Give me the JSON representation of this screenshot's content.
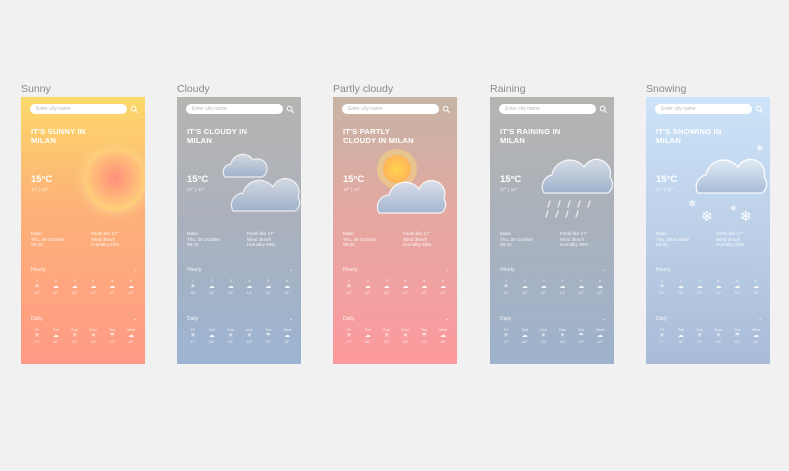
{
  "boards": [
    {
      "title": "Sunny",
      "search_placeholder": "Enter city name",
      "headline": "IT'S SUNNY IN MILAN",
      "temp": "15°C",
      "range": "17° | 12°",
      "info_left": [
        "Milan",
        "Thu, 29 October",
        "09:32"
      ],
      "info_right": [
        "Feels like 17°",
        "Wind 3km/h",
        "Humidity 60%"
      ],
      "hourly_label": "Hourly",
      "daily_label": "Daily",
      "hourly": [
        {
          "t": "1",
          "icon": "sun",
          "v": "15°"
        },
        {
          "t": "2",
          "icon": "cloud",
          "v": "16°"
        },
        {
          "t": "3",
          "icon": "cloud",
          "v": "15°"
        },
        {
          "t": "4",
          "icon": "cloud",
          "v": "14°"
        },
        {
          "t": "5",
          "icon": "cloud",
          "v": "15°"
        },
        {
          "t": "6",
          "icon": "cloud",
          "v": "14°"
        }
      ],
      "daily": [
        {
          "d": "Fri",
          "icon": "sun",
          "v": "17°"
        },
        {
          "d": "Sat",
          "icon": "cloud",
          "v": "16°"
        },
        {
          "d": "Sun",
          "icon": "sun",
          "v": "15°"
        },
        {
          "d": "Mon",
          "icon": "sun",
          "v": "16°"
        },
        {
          "d": "Tue",
          "icon": "rain",
          "v": "13°"
        },
        {
          "d": "Wed",
          "icon": "cloud",
          "v": "14°"
        }
      ]
    },
    {
      "title": "Cloudy",
      "search_placeholder": "Enter city name",
      "headline": "IT'S CLOUDY IN MILAN",
      "temp": "15°C",
      "range": "17° | 12°",
      "info_left": [
        "Milan",
        "Thu, 29 October",
        "09:32"
      ],
      "info_right": [
        "Feels like 17°",
        "Wind 3km/h",
        "Humidity 60%"
      ],
      "hourly_label": "Hourly",
      "daily_label": "Daily",
      "hourly": [
        {
          "t": "1",
          "icon": "sun",
          "v": "15°"
        },
        {
          "t": "2",
          "icon": "cloud",
          "v": "16°"
        },
        {
          "t": "3",
          "icon": "cloud",
          "v": "15°"
        },
        {
          "t": "4",
          "icon": "cloud",
          "v": "14°"
        },
        {
          "t": "5",
          "icon": "cloud",
          "v": "15°"
        },
        {
          "t": "6",
          "icon": "cloud",
          "v": "14°"
        }
      ],
      "daily": [
        {
          "d": "Fri",
          "icon": "sun",
          "v": "17°"
        },
        {
          "d": "Sat",
          "icon": "cloud",
          "v": "16°"
        },
        {
          "d": "Sun",
          "icon": "sun",
          "v": "15°"
        },
        {
          "d": "Mon",
          "icon": "sun",
          "v": "16°"
        },
        {
          "d": "Tue",
          "icon": "rain",
          "v": "13°"
        },
        {
          "d": "Wed",
          "icon": "cloud",
          "v": "14°"
        }
      ]
    },
    {
      "title": "Partly cloudy",
      "search_placeholder": "Enter city name",
      "headline": "IT'S PARTLY CLOUDY IN MILAN",
      "temp": "15°C",
      "range": "17° | 12°",
      "info_left": [
        "Milan",
        "Thu, 29 October",
        "09:32"
      ],
      "info_right": [
        "Feels like 17°",
        "Wind 3km/h",
        "Humidity 60%"
      ],
      "hourly_label": "Hourly",
      "daily_label": "Daily",
      "hourly": [
        {
          "t": "1",
          "icon": "sun",
          "v": "15°"
        },
        {
          "t": "2",
          "icon": "cloud",
          "v": "16°"
        },
        {
          "t": "3",
          "icon": "cloud",
          "v": "15°"
        },
        {
          "t": "4",
          "icon": "cloud",
          "v": "14°"
        },
        {
          "t": "5",
          "icon": "cloud",
          "v": "15°"
        },
        {
          "t": "6",
          "icon": "cloud",
          "v": "14°"
        }
      ],
      "daily": [
        {
          "d": "Fri",
          "icon": "sun",
          "v": "17°"
        },
        {
          "d": "Sat",
          "icon": "cloud",
          "v": "16°"
        },
        {
          "d": "Sun",
          "icon": "sun",
          "v": "15°"
        },
        {
          "d": "Mon",
          "icon": "sun",
          "v": "16°"
        },
        {
          "d": "Tue",
          "icon": "rain",
          "v": "13°"
        },
        {
          "d": "Wed",
          "icon": "cloud",
          "v": "14°"
        }
      ]
    },
    {
      "title": "Raining",
      "search_placeholder": "Enter city name",
      "headline": "IT'S RAINING IN MILAN",
      "temp": "15°C",
      "range": "17° | 12°",
      "info_left": [
        "Milan",
        "Thu, 29 October",
        "09:32"
      ],
      "info_right": [
        "Feels like 17°",
        "Wind 3km/h",
        "Humidity 90%"
      ],
      "hourly_label": "Hourly",
      "daily_label": "Daily",
      "hourly": [
        {
          "t": "1",
          "icon": "sun",
          "v": "15°"
        },
        {
          "t": "2",
          "icon": "cloud",
          "v": "16°"
        },
        {
          "t": "3",
          "icon": "cloud",
          "v": "15°"
        },
        {
          "t": "4",
          "icon": "cloud",
          "v": "14°"
        },
        {
          "t": "5",
          "icon": "cloud",
          "v": "15°"
        },
        {
          "t": "6",
          "icon": "cloud",
          "v": "14°"
        }
      ],
      "daily": [
        {
          "d": "Fri",
          "icon": "sun",
          "v": "17°"
        },
        {
          "d": "Sat",
          "icon": "cloud",
          "v": "16°"
        },
        {
          "d": "Sun",
          "icon": "sun",
          "v": "15°"
        },
        {
          "d": "Mon",
          "icon": "sun",
          "v": "16°"
        },
        {
          "d": "Tue",
          "icon": "rain",
          "v": "13°"
        },
        {
          "d": "Wed",
          "icon": "cloud",
          "v": "14°"
        }
      ]
    },
    {
      "title": "Snowing",
      "search_placeholder": "Enter city name",
      "headline": "IT'S SNOWING IN MILAN",
      "temp": "15°C",
      "range": "17° | 12°",
      "info_left": [
        "Milan",
        "Thu, 29 October",
        "09:32"
      ],
      "info_right": [
        "Feels like 17°",
        "Wind 3km/h",
        "Humidity 60%"
      ],
      "hourly_label": "Hourly",
      "daily_label": "Daily",
      "hourly": [
        {
          "t": "1",
          "icon": "sun",
          "v": "15°"
        },
        {
          "t": "2",
          "icon": "cloud",
          "v": "16°"
        },
        {
          "t": "3",
          "icon": "cloud",
          "v": "15°"
        },
        {
          "t": "4",
          "icon": "cloud",
          "v": "14°"
        },
        {
          "t": "5",
          "icon": "cloud",
          "v": "15°"
        },
        {
          "t": "6",
          "icon": "cloud",
          "v": "14°"
        }
      ],
      "daily": [
        {
          "d": "Fri",
          "icon": "sun",
          "v": "17°"
        },
        {
          "d": "Sat",
          "icon": "cloud",
          "v": "16°"
        },
        {
          "d": "Sun",
          "icon": "sun",
          "v": "15°"
        },
        {
          "d": "Mon",
          "icon": "sun",
          "v": "16°"
        },
        {
          "d": "Tue",
          "icon": "rain",
          "v": "13°"
        },
        {
          "d": "Wed",
          "icon": "cloud",
          "v": "14°"
        }
      ]
    }
  ]
}
